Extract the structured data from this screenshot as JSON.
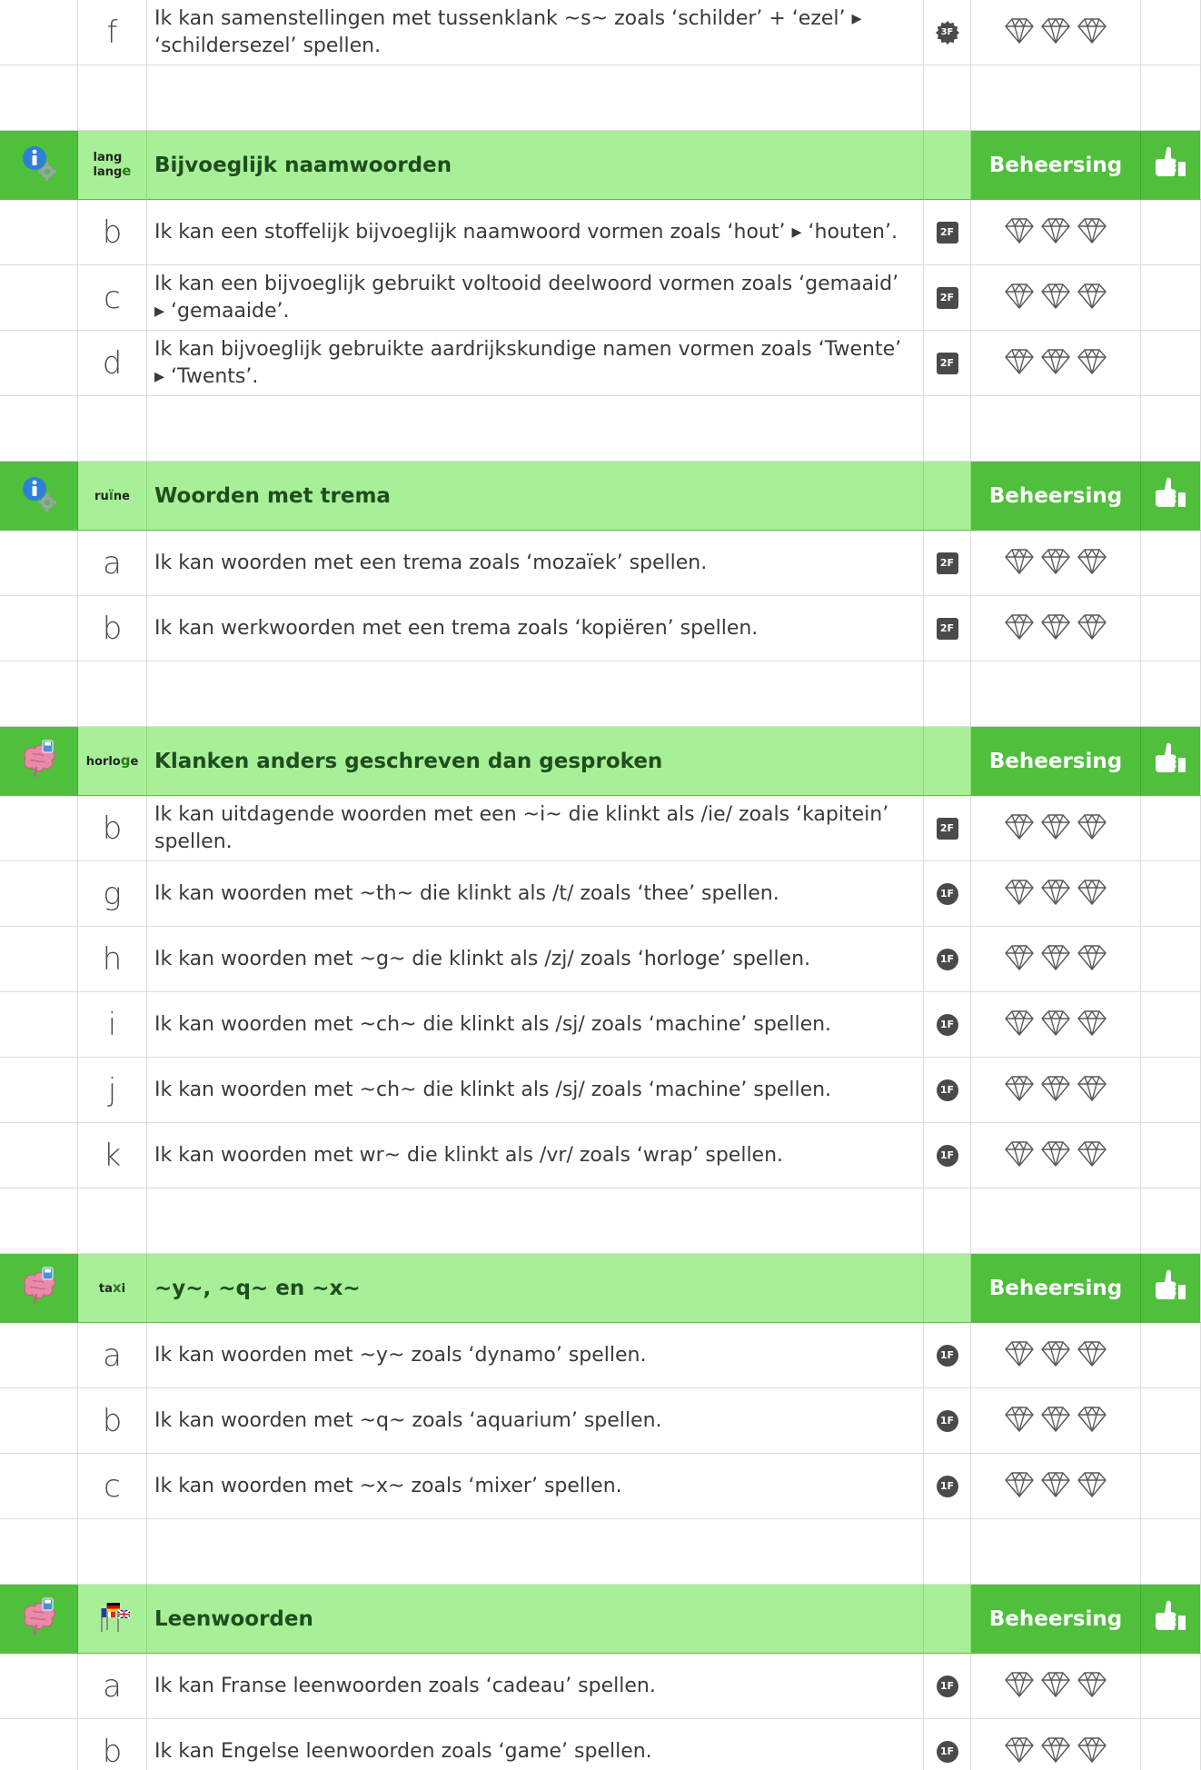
{
  "mastery_label": "Beheersing",
  "sections": [
    {
      "type": "items",
      "items": [
        {
          "letter": "f",
          "text": "Ik kan samenstellingen met tussenklank ~s~ zoals ‘schilder’ + ‘ezel’ ▸ ‘schildersezel’ spellen.",
          "level": "3F",
          "badge": "star"
        }
      ]
    },
    {
      "type": "spacer"
    },
    {
      "type": "header",
      "icon": "info-gear",
      "word_icon": "lang / lange",
      "title": "Bijvoeglijk naamwoorden",
      "items": [
        {
          "letter": "b",
          "text": "Ik kan een stoffelijk bijvoeglijk naamwoord vormen zoals ‘hout’ ▸ ‘houten’.",
          "level": "2F",
          "badge": "square"
        },
        {
          "letter": "c",
          "text": "Ik kan een bijvoeglijk gebruikt voltooid deelwoord vormen zoals ‘gemaaid’ ▸ ‘gemaaide’.",
          "level": "2F",
          "badge": "square"
        },
        {
          "letter": "d",
          "text": "Ik kan bijvoeglijk gebruikte aardrijkskundige namen vormen zoals ‘Twente’ ▸ ‘Twents’.",
          "level": "2F",
          "badge": "square"
        }
      ]
    },
    {
      "type": "spacer"
    },
    {
      "type": "header",
      "icon": "info-gear",
      "word_icon": "ruïne",
      "title": "Woorden met trema",
      "items": [
        {
          "letter": "a",
          "text": "Ik kan woorden met een trema zoals ‘mozaïek’ spellen.",
          "level": "2F",
          "badge": "square"
        },
        {
          "letter": "b",
          "text": "Ik kan werkwoorden met een trema zoals ‘kopiëren’ spellen.",
          "level": "2F",
          "badge": "square"
        }
      ]
    },
    {
      "type": "spacer"
    },
    {
      "type": "header",
      "icon": "brain",
      "word_icon": "horloge",
      "title": "Klanken anders geschreven dan gesproken",
      "items": [
        {
          "letter": "b",
          "text": "Ik kan uitdagende woorden met een ~i~ die klinkt als /ie/ zoals ‘kapitein’ spellen.",
          "level": "2F",
          "badge": "square"
        },
        {
          "letter": "g",
          "text": "Ik kan woorden met ~th~ die klinkt als /t/ zoals ‘thee’ spellen.",
          "level": "1F",
          "badge": "circle"
        },
        {
          "letter": "h",
          "text": "Ik kan woorden met ~g~ die klinkt als /zj/ zoals ‘horloge’ spellen.",
          "level": "1F",
          "badge": "circle"
        },
        {
          "letter": "i",
          "text": "Ik kan woorden met ~ch~ die klinkt als /sj/ zoals ‘machine’ spellen.",
          "level": "1F",
          "badge": "circle"
        },
        {
          "letter": "j",
          "text": "Ik kan woorden met ~ch~ die klinkt als /sj/ zoals ‘machine’ spellen.",
          "level": "1F",
          "badge": "circle"
        },
        {
          "letter": "k",
          "text": "Ik kan woorden met wr~ die klinkt als /vr/ zoals ‘wrap’ spellen.",
          "level": "1F",
          "badge": "circle"
        }
      ]
    },
    {
      "type": "spacer"
    },
    {
      "type": "header",
      "icon": "brain",
      "word_icon": "taxi",
      "title": "~y~, ~q~ en ~x~",
      "items": [
        {
          "letter": "a",
          "text": "Ik kan woorden met ~y~ zoals ‘dynamo’ spellen.",
          "level": "1F",
          "badge": "circle"
        },
        {
          "letter": "b",
          "text": "Ik kan woorden met ~q~ zoals ‘aquarium’ spellen.",
          "level": "1F",
          "badge": "circle"
        },
        {
          "letter": "c",
          "text": "Ik kan woorden met ~x~ zoals ‘mixer’ spellen.",
          "level": "1F",
          "badge": "circle"
        }
      ]
    },
    {
      "type": "spacer"
    },
    {
      "type": "header",
      "icon": "brain",
      "word_icon": "flags",
      "title": "Leenwoorden",
      "items": [
        {
          "letter": "a",
          "text": "Ik kan Franse leenwoorden zoals ‘cadeau’ spellen.",
          "level": "1F",
          "badge": "circle"
        },
        {
          "letter": "b",
          "text": "Ik kan Engelse leenwoorden zoals ‘game’ spellen.",
          "level": "1F",
          "badge": "circle"
        }
      ]
    }
  ],
  "colors": {
    "header_dark": "#4fbf3c",
    "header_light": "#a8f097",
    "badge": "#4a4a4a",
    "title_text": "#1f4d1f"
  }
}
